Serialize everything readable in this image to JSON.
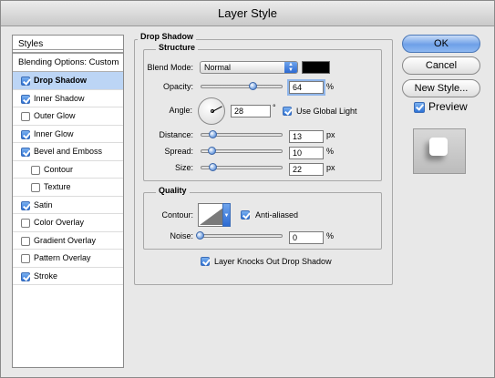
{
  "window": {
    "title": "Layer Style"
  },
  "styles_list": {
    "header": "Styles",
    "blending_options": "Blending Options: Custom",
    "items": [
      {
        "label": "Drop Shadow",
        "checked": true,
        "selected": true,
        "indent": false
      },
      {
        "label": "Inner Shadow",
        "checked": true,
        "selected": false,
        "indent": false
      },
      {
        "label": "Outer Glow",
        "checked": false,
        "selected": false,
        "indent": false
      },
      {
        "label": "Inner Glow",
        "checked": true,
        "selected": false,
        "indent": false
      },
      {
        "label": "Bevel and Emboss",
        "checked": true,
        "selected": false,
        "indent": false
      },
      {
        "label": "Contour",
        "checked": false,
        "selected": false,
        "indent": true
      },
      {
        "label": "Texture",
        "checked": false,
        "selected": false,
        "indent": true
      },
      {
        "label": "Satin",
        "checked": true,
        "selected": false,
        "indent": false
      },
      {
        "label": "Color Overlay",
        "checked": false,
        "selected": false,
        "indent": false
      },
      {
        "label": "Gradient Overlay",
        "checked": false,
        "selected": false,
        "indent": false
      },
      {
        "label": "Pattern Overlay",
        "checked": false,
        "selected": false,
        "indent": false
      },
      {
        "label": "Stroke",
        "checked": true,
        "selected": false,
        "indent": false
      }
    ]
  },
  "drop_shadow": {
    "title": "Drop Shadow",
    "structure": {
      "title": "Structure",
      "blend_mode_label": "Blend Mode:",
      "blend_mode_value": "Normal",
      "shadow_color": "#000000",
      "opacity_label": "Opacity:",
      "opacity_value": "64",
      "opacity_unit": "%",
      "opacity_fraction": 0.64,
      "angle_label": "Angle:",
      "angle_value": "28",
      "angle_unit": "°",
      "use_global_light_label": "Use Global Light",
      "use_global_light": true,
      "distance_label": "Distance:",
      "distance_value": "13",
      "distance_unit": "px",
      "spread_label": "Spread:",
      "spread_value": "10",
      "spread_unit": "%",
      "size_label": "Size:",
      "size_value": "22",
      "size_unit": "px"
    },
    "quality": {
      "title": "Quality",
      "contour_label": "Contour:",
      "anti_aliased_label": "Anti-aliased",
      "anti_aliased": true,
      "noise_label": "Noise:",
      "noise_value": "0",
      "noise_unit": "%"
    },
    "layer_knocks_out_label": "Layer Knocks Out Drop Shadow",
    "layer_knocks_out": true
  },
  "buttons": {
    "ok": "OK",
    "cancel": "Cancel",
    "new_style": "New Style...",
    "preview_label": "Preview",
    "preview_checked": true
  },
  "colors": {
    "accent": "#3d72c6",
    "selection": "#bcd5f5"
  }
}
